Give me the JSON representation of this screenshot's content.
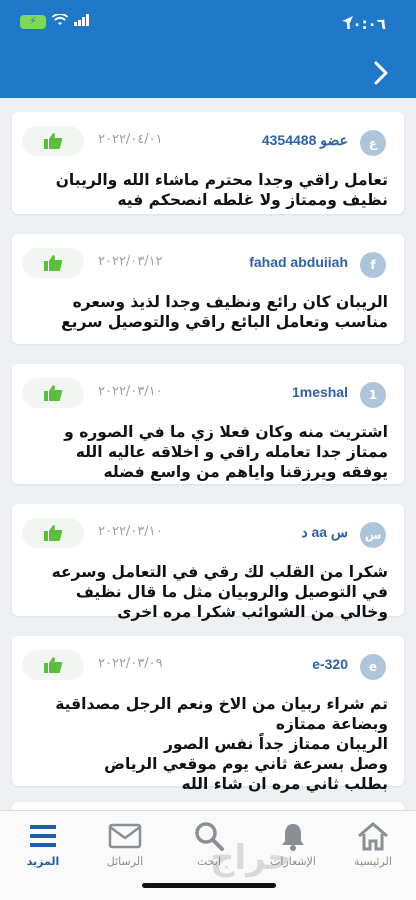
{
  "status_bar": {
    "time": "١٠:٠٦",
    "battery": "⚡"
  },
  "reviews": [
    {
      "avatar": "ع",
      "username": "عضو 4354488",
      "date": "٢٠٢٢/٠٤/٠١",
      "text": "تعامل راقي وجدا محترم ماشاء الله والريبان نظيف وممتاز ولا غلطه انصحكم فيه"
    },
    {
      "avatar": "f",
      "username": "fahad abduiiah",
      "date": "٢٠٢٢/٠٣/١٢",
      "text": "الريبان كان رائع ونظيف وجدا لذيذ وسعره مناسب وتعامل البائع راقي والتوصيل سريع"
    },
    {
      "avatar": "1",
      "username": "1meshal",
      "date": "٢٠٢٢/٠٣/١٠",
      "text": "اشتريت منه وكان فعلا زي ما في الصوره و ممتاز جدا تعامله راقي و اخلاقه عاليه الله يوفقه ويرزقنا واياهم من واسع فضله"
    },
    {
      "avatar": "س",
      "username": "س aa د",
      "date": "٢٠٢٢/٠٣/١٠",
      "text": "شكرا من القلب لك رقي في التعامل وسرعه في التوصيل والروبيان مثل ما قال نظيف وخالي من الشوائب شكرا مره اخرى"
    },
    {
      "avatar": "e",
      "username": "e-320",
      "date": "٢٠٢٢/٠٣/٠٩",
      "text": "تم شراء ربيان من الاخ ونعم الرجل مصداقية وبضاعة ممتازه\nالريبان ممتاز جداً نفس الصور\nوصل بسرعة ثاني يوم موقعي الرياض\nبطلب ثاني مره ان شاء الله"
    }
  ],
  "tabs": [
    {
      "label": "الرئيسية",
      "icon": "home-icon"
    },
    {
      "label": "الإشعارات",
      "icon": "bell-icon"
    },
    {
      "label": "ابحث",
      "icon": "search-icon"
    },
    {
      "label": "الرسائل",
      "icon": "mail-icon"
    },
    {
      "label": "المزيد",
      "icon": "menu-icon"
    }
  ],
  "watermark": "حراج",
  "colors": {
    "header": "#1f78c8",
    "like_green": "#5bbf3a",
    "username": "#2e62a6",
    "active_tab": "#1f5fa8"
  }
}
